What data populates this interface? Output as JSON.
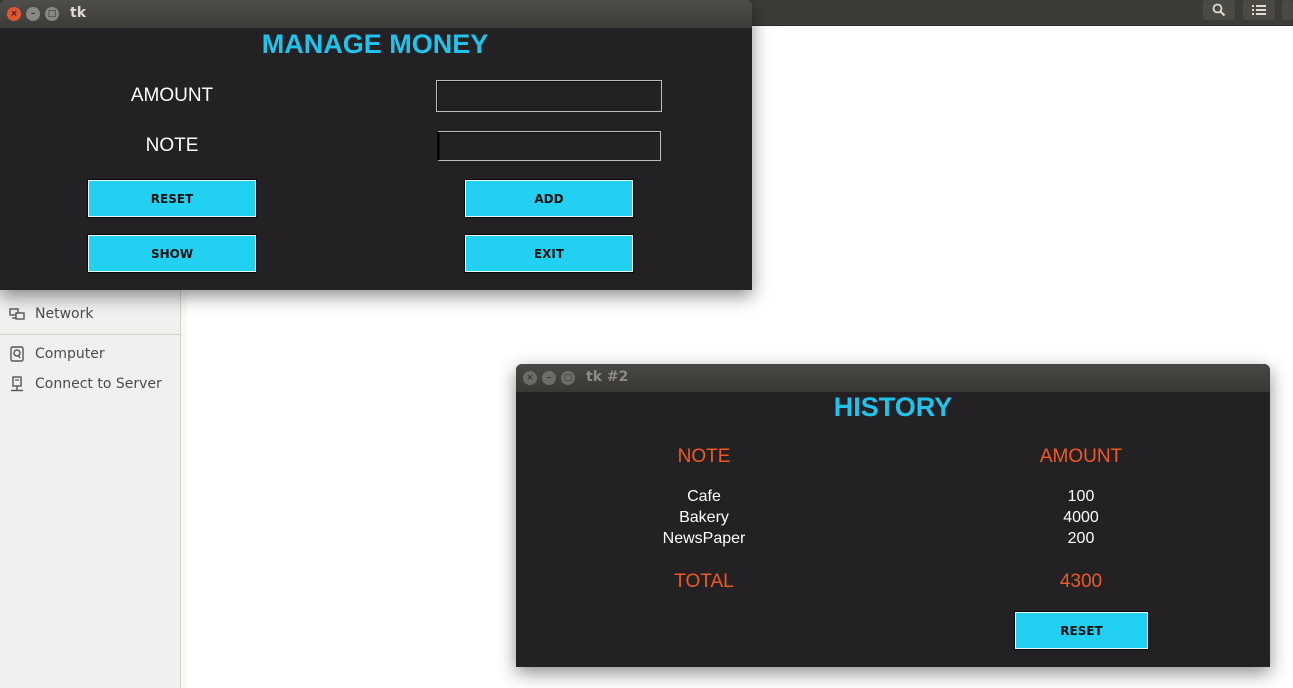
{
  "background_app": {
    "sidebar_items": [
      {
        "label": "Network",
        "icon": "network-icon"
      },
      {
        "label": "Computer",
        "icon": "computer-icon"
      },
      {
        "label": "Connect to Server",
        "icon": "server-icon"
      }
    ],
    "toolbar_icons": [
      "search-icon",
      "list-view-icon"
    ]
  },
  "manage_window": {
    "title": "tk",
    "heading": "MANAGE MONEY",
    "amount_label": "AMOUNT",
    "note_label": "NOTE",
    "amount_value": "",
    "note_value": "",
    "buttons": {
      "reset": "RESET",
      "add": "ADD",
      "show": "SHOW",
      "exit": "EXIT"
    }
  },
  "history_window": {
    "title": "tk #2",
    "heading": "HISTORY",
    "columns": {
      "note": "NOTE",
      "amount": "AMOUNT"
    },
    "rows": [
      {
        "note": "Cafe",
        "amount": "100"
      },
      {
        "note": "Bakery",
        "amount": "4000"
      },
      {
        "note": "NewsPaper",
        "amount": "200"
      }
    ],
    "total_label": "TOTAL",
    "total_value": "4300",
    "reset_label": "RESET"
  },
  "colors": {
    "accent": "#1fc3ec",
    "button": "#22d1f2",
    "highlight": "#f05a22",
    "window_bg": "#232123"
  }
}
